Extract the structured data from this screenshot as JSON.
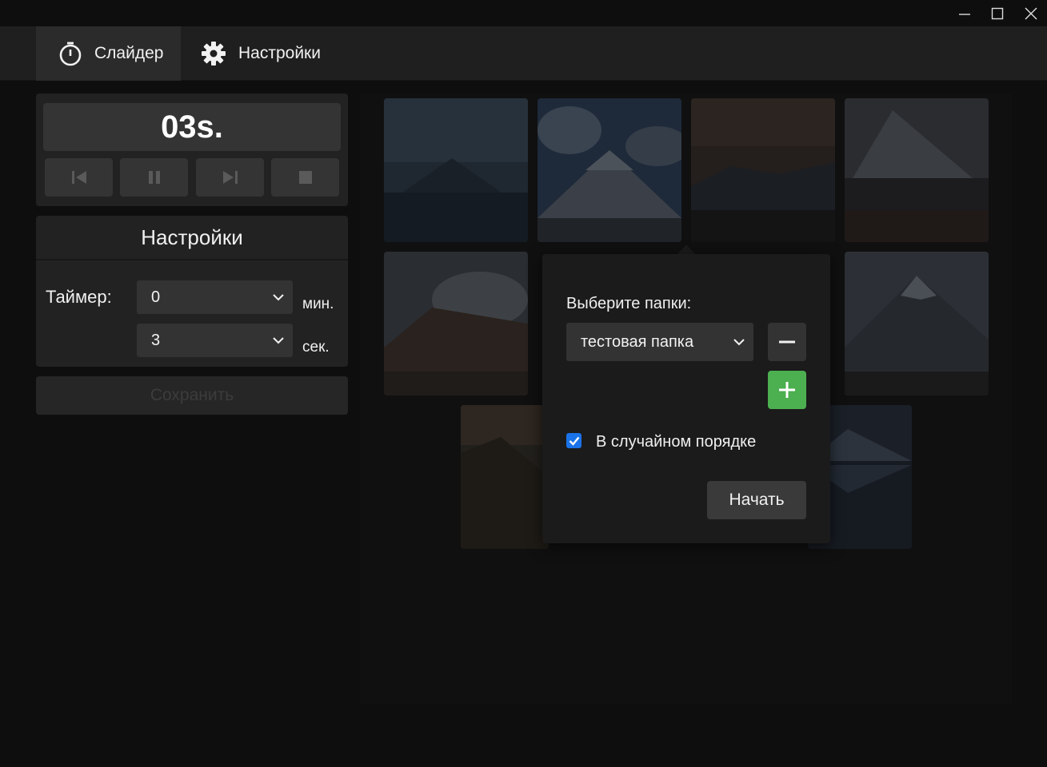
{
  "window_controls": {
    "minimize": "minimize-icon",
    "maximize": "maximize-icon",
    "close": "close-icon"
  },
  "nav": {
    "tabs": [
      {
        "label": "Слайдер",
        "icon": "stopwatch-icon",
        "active": true
      },
      {
        "label": "Настройки",
        "icon": "gear-icon",
        "active": false
      }
    ]
  },
  "player": {
    "timer_display": "03s.",
    "controls": [
      "skip-previous-icon",
      "pause-icon",
      "skip-next-icon",
      "stop-icon"
    ]
  },
  "settings": {
    "title": "Настройки",
    "timer_label": "Таймер:",
    "minutes_value": "0",
    "minutes_unit": "мин.",
    "seconds_value": "3",
    "seconds_unit": "сек.",
    "save_label": "Сохранить"
  },
  "popup": {
    "title": "Выберите папки:",
    "folder_value": "тестовая папка",
    "remove_icon": "minus-icon",
    "add_icon": "plus-icon",
    "random_label": "В случайном порядке",
    "random_checked": true,
    "start_label": "Начать"
  },
  "colors": {
    "accent_green": "#4caf50",
    "checkbox_blue": "#1a73e8",
    "background": "#0e0e0e",
    "panel": "#222222"
  }
}
